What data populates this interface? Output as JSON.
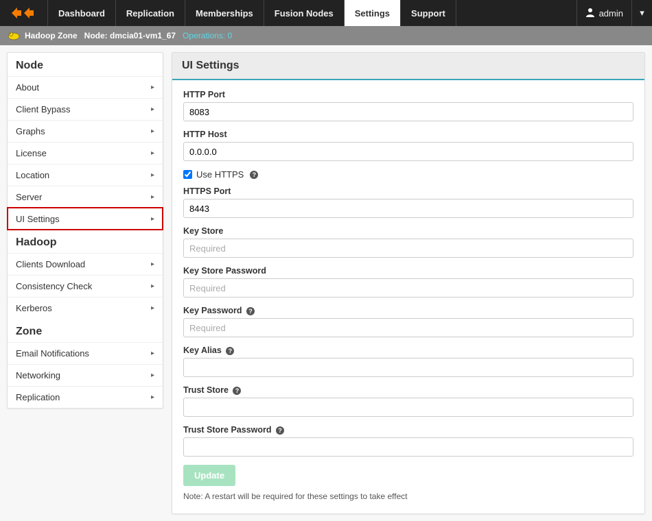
{
  "topnav": {
    "items": [
      {
        "label": "Dashboard"
      },
      {
        "label": "Replication"
      },
      {
        "label": "Memberships"
      },
      {
        "label": "Fusion Nodes"
      },
      {
        "label": "Settings",
        "active": true
      },
      {
        "label": "Support"
      }
    ],
    "user_label": "admin"
  },
  "subnav": {
    "zone_label": "Hadoop Zone",
    "node_prefix": "Node: ",
    "node_id": "dmcia01-vm1_67",
    "operations_label": "Operations: 0"
  },
  "sidebar": {
    "groups": [
      {
        "title": "Node",
        "items": [
          {
            "label": "About"
          },
          {
            "label": "Client Bypass"
          },
          {
            "label": "Graphs"
          },
          {
            "label": "License"
          },
          {
            "label": "Location"
          },
          {
            "label": "Server"
          },
          {
            "label": "UI Settings",
            "selected": true
          }
        ]
      },
      {
        "title": "Hadoop",
        "items": [
          {
            "label": "Clients Download"
          },
          {
            "label": "Consistency Check"
          },
          {
            "label": "Kerberos"
          }
        ]
      },
      {
        "title": "Zone",
        "items": [
          {
            "label": "Email Notifications"
          },
          {
            "label": "Networking"
          },
          {
            "label": "Replication"
          }
        ]
      }
    ]
  },
  "panel": {
    "title": "UI Settings",
    "fields": {
      "http_port": {
        "label": "HTTP Port",
        "value": "8083"
      },
      "http_host": {
        "label": "HTTP Host",
        "value": "0.0.0.0"
      },
      "use_https": {
        "label": "Use HTTPS",
        "checked": true
      },
      "https_port": {
        "label": "HTTPS Port",
        "value": "8443"
      },
      "key_store": {
        "label": "Key Store",
        "placeholder": "Required"
      },
      "key_store_password": {
        "label": "Key Store Password",
        "placeholder": "Required"
      },
      "key_password": {
        "label": "Key Password",
        "placeholder": "Required"
      },
      "key_alias": {
        "label": "Key Alias",
        "value": ""
      },
      "trust_store": {
        "label": "Trust Store",
        "value": ""
      },
      "trust_store_password": {
        "label": "Trust Store Password",
        "value": ""
      }
    },
    "update_label": "Update",
    "note": "Note: A restart will be required for these settings to take effect"
  }
}
